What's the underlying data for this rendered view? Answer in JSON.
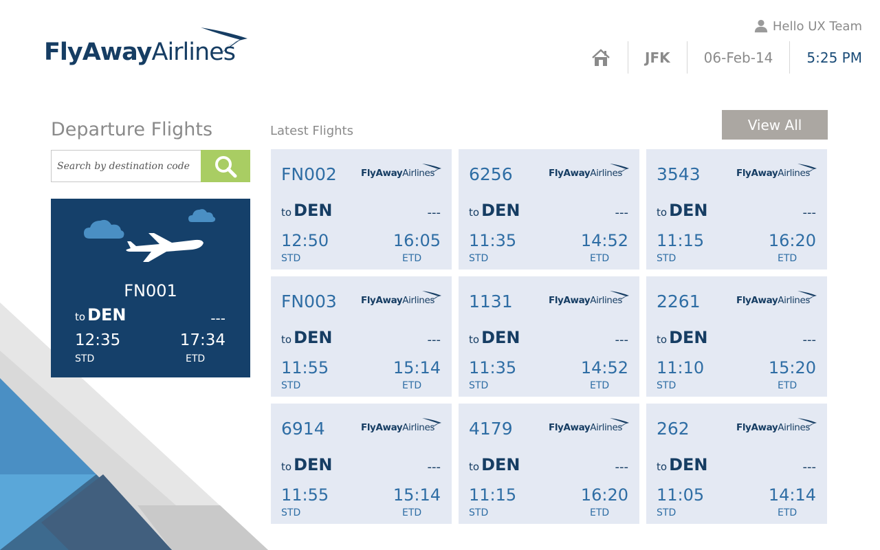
{
  "brand": {
    "name_bold": "FlyAway",
    "name_light": "Airlines"
  },
  "header": {
    "greeting": "Hello UX Team",
    "airport": "JFK",
    "date": "06-Feb-14",
    "time": "5:25 PM"
  },
  "departures": {
    "title": "Departure Flights",
    "search_placeholder": "Search by destination code",
    "featured": {
      "flight": "FN001",
      "to_label": "to",
      "destination": "DEN",
      "status": "---",
      "std": "12:35",
      "etd": "17:34",
      "std_label": "STD",
      "etd_label": "ETD"
    }
  },
  "latest": {
    "title": "Latest Flights",
    "view_all_label": "View All",
    "flights": [
      {
        "flight": "FN002",
        "to_label": "to",
        "destination": "DEN",
        "status": "---",
        "std": "12:50",
        "etd": "16:05",
        "std_label": "STD",
        "etd_label": "ETD"
      },
      {
        "flight": "6256",
        "to_label": "to",
        "destination": "DEN",
        "status": "---",
        "std": "11:35",
        "etd": "14:52",
        "std_label": "STD",
        "etd_label": "ETD"
      },
      {
        "flight": "3543",
        "to_label": "to",
        "destination": "DEN",
        "status": "---",
        "std": "11:15",
        "etd": "16:20",
        "std_label": "STD",
        "etd_label": "ETD"
      },
      {
        "flight": "FN003",
        "to_label": "to",
        "destination": "DEN",
        "status": "---",
        "std": "11:55",
        "etd": "15:14",
        "std_label": "STD",
        "etd_label": "ETD"
      },
      {
        "flight": "1131",
        "to_label": "to",
        "destination": "DEN",
        "status": "---",
        "std": "11:35",
        "etd": "14:52",
        "std_label": "STD",
        "etd_label": "ETD"
      },
      {
        "flight": "2261",
        "to_label": "to",
        "destination": "DEN",
        "status": "---",
        "std": "11:10",
        "etd": "15:20",
        "std_label": "STD",
        "etd_label": "ETD"
      },
      {
        "flight": "6914",
        "to_label": "to",
        "destination": "DEN",
        "status": "---",
        "std": "11:55",
        "etd": "15:14",
        "std_label": "STD",
        "etd_label": "ETD"
      },
      {
        "flight": "4179",
        "to_label": "to",
        "destination": "DEN",
        "status": "---",
        "std": "11:15",
        "etd": "16:20",
        "std_label": "STD",
        "etd_label": "ETD"
      },
      {
        "flight": "262",
        "to_label": "to",
        "destination": "DEN",
        "status": "---",
        "std": "11:05",
        "etd": "14:14",
        "std_label": "STD",
        "etd_label": "ETD"
      }
    ]
  },
  "icons": {
    "user": "user-icon",
    "home": "home-icon",
    "search": "search-icon",
    "cloud": "cloud-icon",
    "airplane": "airplane-icon",
    "logo": "logo-swoosh-icon"
  },
  "colors": {
    "navy": "#15406a",
    "accent_green": "#a9cd63",
    "card_bg": "#e4e9f3",
    "card_text": "#2e6da4",
    "view_all_bg": "#aba7a2",
    "muted_text": "#8a8a8a"
  }
}
